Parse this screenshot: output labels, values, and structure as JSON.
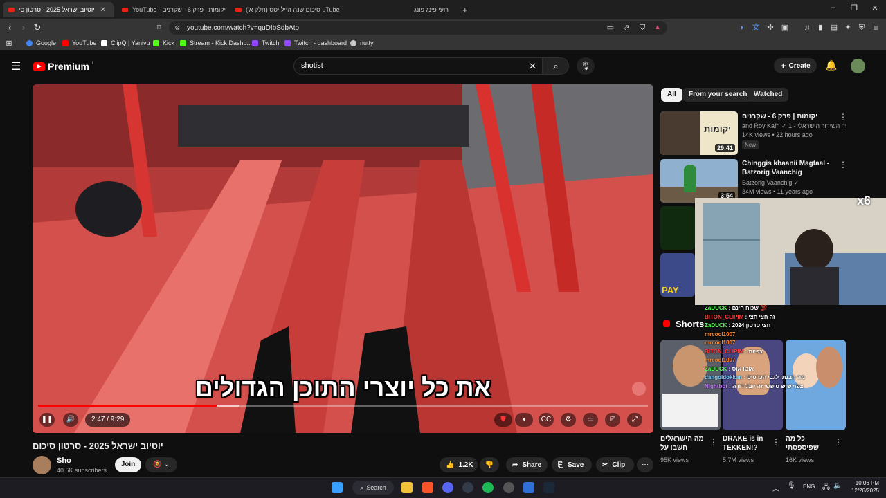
{
  "browser": {
    "tabs": [
      {
        "label": "יוטיוב ישראל 2025 - סרטון סי",
        "active": true
      },
      {
        "label": "YouTube - יקומות | פרק 6 - שקרנים",
        "active": false
      },
      {
        "label": "סיכום שנה היילייטס (חלק א') uTube -",
        "active": false
      },
      {
        "label": "רועי פינג פונג",
        "active": false
      }
    ],
    "new_tab": "+",
    "url": "youtube.com/watch?v=quDIbSdbAto",
    "bookmarks": [
      "Google",
      "YouTube",
      "ClipQ | Yanivu",
      "Kick",
      "Stream - Kick Dashb...",
      "Twitch",
      "Twitch - dashboard",
      "nutty"
    ]
  },
  "youtube": {
    "logo": "Premium",
    "logo_region": "IL",
    "search_value": "shotist",
    "create_label": "Create"
  },
  "player": {
    "caption": "את כל יוצרי התוכן הגדולים",
    "time": "2:47 / 9:29",
    "progress_fraction": 0.293,
    "buffered_fraction": 0.33
  },
  "video": {
    "title": "יוטיוב ישראל 2025 - סרטון סיכום",
    "channel": "Sho",
    "subscribers": "40.5K subscribers",
    "join_label": "Join",
    "likes": "1.2K",
    "share_label": "Share",
    "save_label": "Save",
    "clip_label": "Clip"
  },
  "sidebar": {
    "chips": [
      "All",
      "From your search",
      "Watched"
    ],
    "recommendations": [
      {
        "title": "יקומות | פרק 6 - שקרנים",
        "channel": "and Roy Kafri ✓ התאגיד השידור הישראלי - 1...",
        "meta": "14K views • 22 hours ago",
        "badge": "New",
        "duration": "29:41",
        "thumb_label": "יקומות"
      },
      {
        "title": "Chinggis khaanii Magtaal - Batzorig Vaanchig",
        "channel": "Batzorig Vaanchig ✓",
        "meta": "34M views • 11 years ago",
        "badge": "",
        "duration": "3:54",
        "thumb_label": ""
      }
    ],
    "stream_overlay_tag": "x6",
    "thumb_partial_label": "PAY",
    "shorts_label": "Shorts",
    "shorts": [
      {
        "title": "מה הישראלים חשבו על",
        "views": "95K views"
      },
      {
        "title": "DRAKE is in TEKKEN!?",
        "views": "5.7M views"
      },
      {
        "title": "כל מה שפיספסתי",
        "views": "16K views"
      }
    ]
  },
  "chat": [
    {
      "user": "ZaDUCK",
      "msg": "שכוח חינם 💯"
    },
    {
      "user": "BITON_CLIPIM",
      "msg": "זה חצי חצי"
    },
    {
      "user": "ZaDUCK",
      "msg": "חצי סרטון 2024"
    },
    {
      "user": "mrcool1007",
      "msg": ""
    },
    {
      "user": "mrcool1007",
      "msg": ""
    },
    {
      "user": "BITON_CLIPIM",
      "msg": "צפיות"
    },
    {
      "user": "mrcool1007",
      "msg": ""
    },
    {
      "user": "ZaDUCK",
      "msg": "אוטו אוס"
    },
    {
      "user": "dangoldokkan",
      "msg": "מה הבנתי לגבי הכרטיס"
    },
    {
      "user": "Nightbot",
      "msg": "צפוי שיש טיפשי זה יובל דורה"
    }
  ],
  "taskbar": {
    "search_label": "Search",
    "language": "ENG",
    "time": "10:06 PM",
    "date": "12/26/2025"
  }
}
